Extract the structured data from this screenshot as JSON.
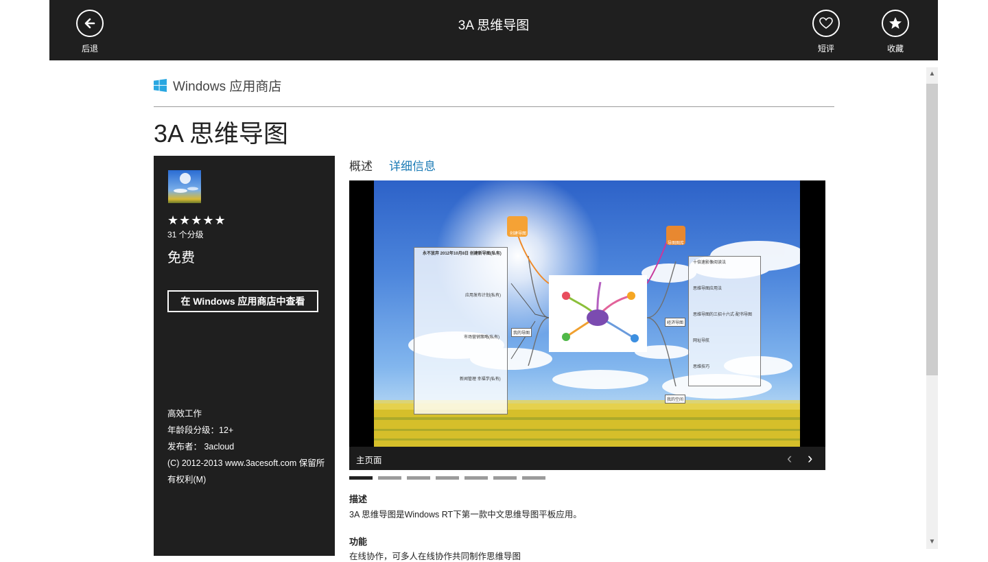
{
  "header": {
    "title": "3A 思维导图",
    "back_label": "后退",
    "review_label": "短评",
    "favorite_label": "收藏"
  },
  "store": {
    "brand": "Windows 应用商店"
  },
  "app": {
    "title": "3A 思维导图",
    "rating_stars": 5,
    "stars_text": "★★★★★",
    "rating_count": "31 个分级",
    "price": "免费",
    "store_button": "在 Windows 应用商店中查看",
    "category": "高效工作",
    "age_rating": "年龄段分级：12+",
    "publisher": "发布者： 3acloud",
    "copyright": "(C) 2012-2013 www.3acesoft.com 保留所有权利(M)"
  },
  "tabs": [
    {
      "label": "概述"
    },
    {
      "label": "详细信息"
    }
  ],
  "screenshot": {
    "caption": "主页面",
    "current_index": 1,
    "total": 7
  },
  "description": {
    "heading": "描述",
    "text": "3A 思维导图是Windows RT下第一款中文思维导图平板应用。"
  },
  "features": {
    "heading": "功能",
    "text": "在线协作，可多人在线协作共同制作思维导图"
  },
  "mindmap": {
    "left_items": [
      "永不放弃 2012年10月8日 创建新导图(私有)",
      "应用发布计划(私有)",
      "市场营销策略(私有)",
      "新闻管理 幸福学(私有)"
    ],
    "right_items": [
      "十倍速影像阅读法",
      "思维导图应用法",
      "思维导图的三招十六式·配书导图",
      "网址导航",
      "思维技巧"
    ],
    "nodes": [
      "创建导图",
      "导图图库",
      "我的导图",
      "经济导图",
      "我的空间"
    ]
  },
  "colors": {
    "topbar": "#1f1f1f",
    "accent_link": "#1a7ab5",
    "windows_logo": "#29a7e1"
  }
}
